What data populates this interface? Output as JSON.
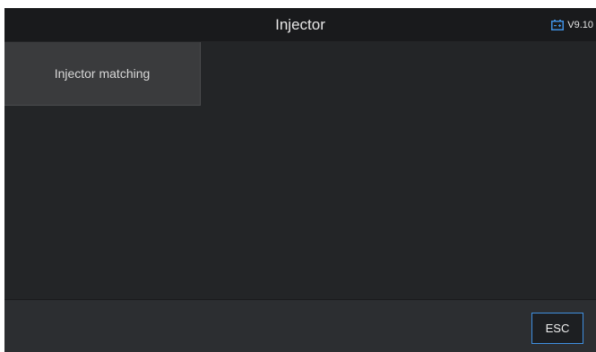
{
  "header": {
    "title": "Injector",
    "version": "V9.10",
    "battery_icon": "battery-icon",
    "battery_color": "#3f8fe0"
  },
  "menu": {
    "items": [
      {
        "label": "Injector matching"
      }
    ]
  },
  "footer": {
    "esc_label": "ESC"
  },
  "colors": {
    "screen_bg": "#232527",
    "header_bg": "#191a1c",
    "menu_item_bg": "#3a3b3d",
    "footer_bg": "#2c2e31",
    "accent": "#3f8fe0"
  }
}
